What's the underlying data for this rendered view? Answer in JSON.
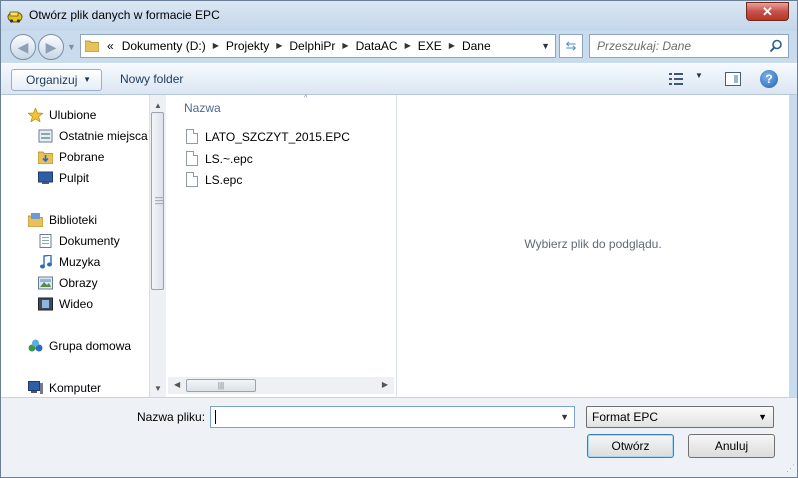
{
  "window": {
    "title": "Otwórz plik danych w formacie EPC",
    "close_label": "✕"
  },
  "address": {
    "overflow": "«",
    "crumbs": [
      "Dokumenty (D:)",
      "Projekty",
      "DelphiPr",
      "DataAC",
      "EXE",
      "Dane"
    ],
    "separator": "▶",
    "dropdown": "▼"
  },
  "search": {
    "placeholder": "Przeszukaj: Dane"
  },
  "toolbar": {
    "organize": "Organizuj",
    "new_folder": "Nowy folder",
    "help": "?"
  },
  "nav": {
    "favorites": {
      "label": "Ulubione",
      "items": [
        "Ostatnie miejsca",
        "Pobrane",
        "Pulpit"
      ]
    },
    "libraries": {
      "label": "Biblioteki",
      "items": [
        "Dokumenty",
        "Muzyka",
        "Obrazy",
        "Wideo"
      ]
    },
    "homegroup": "Grupa domowa",
    "computer": "Komputer"
  },
  "files": {
    "column_name": "Nazwa",
    "items": [
      "LATO_SZCZYT_2015.EPC",
      "LS.~.epc",
      "LS.epc"
    ]
  },
  "preview": {
    "message": "Wybierz plik do podglądu."
  },
  "bottom": {
    "filename_label": "Nazwa pliku:",
    "filename_value": "",
    "filter": "Format EPC",
    "open_button": "Otwórz",
    "cancel_button": "Anuluj"
  },
  "colors": {
    "chrome": "#c9dced",
    "link_text": "#1b3a5b",
    "column_header": "#4b6b91"
  }
}
